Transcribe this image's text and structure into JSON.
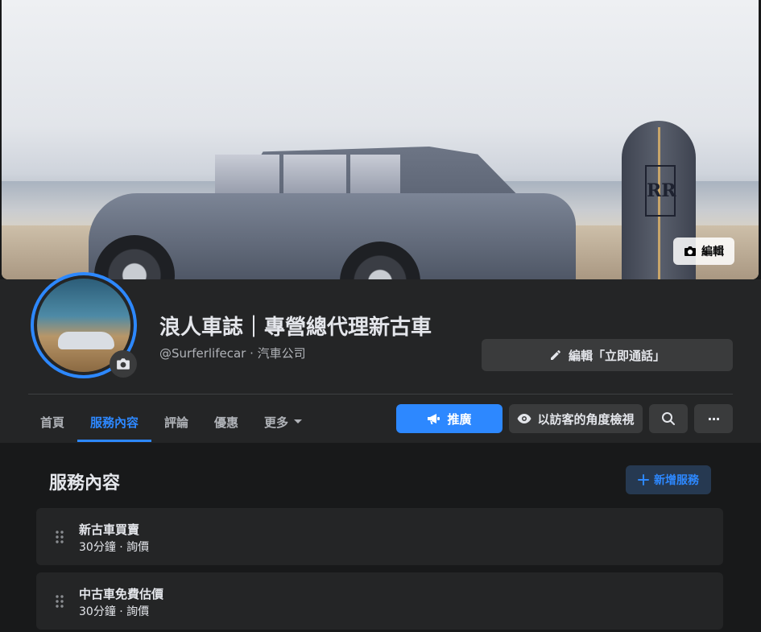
{
  "cover": {
    "edit_label": "編輯",
    "board_logo": "RR"
  },
  "profile": {
    "title": "浪人車誌｜專營總代理新古車",
    "handle": "@Surferlifecar",
    "separator": " · ",
    "category": "汽車公司",
    "edit_call_label": "編輯「立即通話」"
  },
  "tabs": [
    {
      "label": "首頁"
    },
    {
      "label": "服務內容"
    },
    {
      "label": "評論"
    },
    {
      "label": "優惠"
    },
    {
      "label": "更多"
    }
  ],
  "actions": {
    "promote_label": "推廣",
    "view_as_visitor_label": "以訪客的角度檢視",
    "more_glyph": "···"
  },
  "services_section": {
    "title": "服務內容",
    "add_label": "新增服務"
  },
  "services": [
    {
      "name": "新古車買賣",
      "meta": "30分鐘 · 詢價"
    },
    {
      "name": "中古車免費估價",
      "meta": "30分鐘 · 詢價"
    }
  ],
  "colors": {
    "accent": "#2d88ff",
    "background": "#18191a",
    "surface": "#242526"
  }
}
